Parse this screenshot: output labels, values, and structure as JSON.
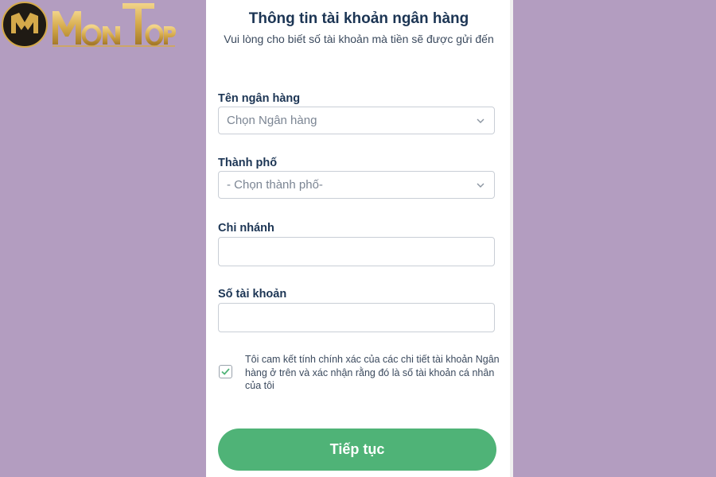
{
  "logo": {
    "brand_text": "MonTop",
    "badge_letter": "M",
    "colors": {
      "gold": "#d4a94a",
      "badge_bg": "#1f1a14"
    }
  },
  "form": {
    "title": "Thông tin tài khoản ngân hàng",
    "subtitle": "Vui lòng cho biết số tài khoản mà tiền sẽ được gửi đến",
    "bank": {
      "label": "Tên ngân hàng",
      "selected": "Chọn Ngân hàng"
    },
    "city": {
      "label": "Thành phố",
      "selected": "- Chọn thành phố-"
    },
    "branch": {
      "label": "Chi nhánh",
      "value": ""
    },
    "account": {
      "label": "Số tài khoản",
      "value": ""
    },
    "consent": {
      "checked": true,
      "text": "Tôi cam kết tính chính xác của các chi tiết tài khoản Ngân hàng ở trên và xác nhận rằng đó là số tài khoản cá nhân của tôi"
    },
    "submit_label": "Tiếp tục"
  },
  "colors": {
    "page_bg": "#b39dc0",
    "primary_green": "#4fb377",
    "heading": "#1c3554"
  },
  "icons": {
    "dropdown": "chevron-down-icon",
    "check": "check-icon",
    "logo": "logo-icon"
  }
}
